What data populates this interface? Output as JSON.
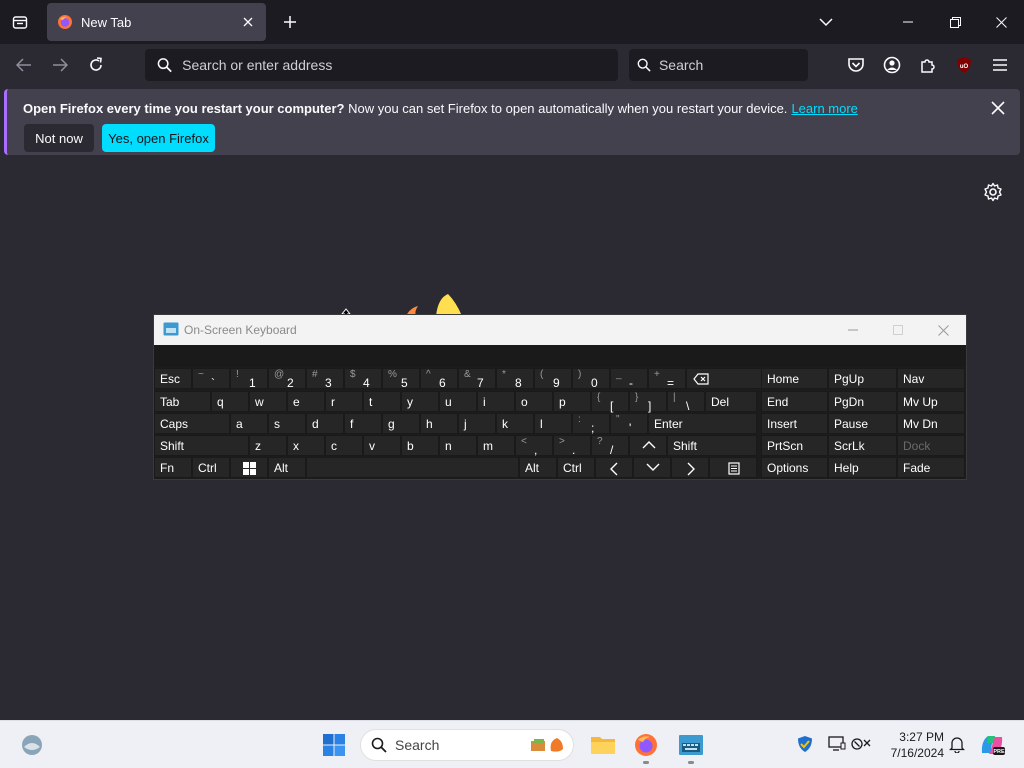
{
  "browser": {
    "tab": {
      "title": "New Tab"
    },
    "urlbar": {
      "placeholder": "Search or enter address"
    },
    "searchbar": {
      "placeholder": "Search"
    }
  },
  "notification": {
    "bold": "Open Firefox every time you restart your computer?",
    "text": " Now you can set Firefox to open automatically when you restart your device.",
    "link": "Learn more",
    "btn_not_now": "Not now",
    "btn_yes": "Yes, open Firefox"
  },
  "osk": {
    "title": "On-Screen Keyboard",
    "row1": [
      {
        "up": "~",
        "lo": "`"
      },
      {
        "up": "!",
        "lo": "1"
      },
      {
        "up": "@",
        "lo": "2"
      },
      {
        "up": "#",
        "lo": "3"
      },
      {
        "up": "$",
        "lo": "4"
      },
      {
        "up": "%",
        "lo": "5"
      },
      {
        "up": "^",
        "lo": "6"
      },
      {
        "up": "&",
        "lo": "7"
      },
      {
        "up": "*",
        "lo": "8"
      },
      {
        "up": "(",
        "lo": "9"
      },
      {
        "up": ")",
        "lo": "0"
      },
      {
        "up": "_",
        "lo": "-"
      },
      {
        "up": "+",
        "lo": "="
      }
    ],
    "letters_row2": [
      "q",
      "w",
      "e",
      "r",
      "t",
      "y",
      "u",
      "i",
      "o",
      "p"
    ],
    "row2_sym": [
      {
        "up": "{",
        "lo": "["
      },
      {
        "up": "}",
        "lo": "]"
      },
      {
        "up": "|",
        "lo": "\\"
      }
    ],
    "letters_row3": [
      "a",
      "s",
      "d",
      "f",
      "g",
      "h",
      "j",
      "k",
      "l"
    ],
    "row3_sym": [
      {
        "up": ":",
        "lo": ";"
      },
      {
        "up": "\"",
        "lo": "'"
      }
    ],
    "letters_row4": [
      "z",
      "x",
      "c",
      "v",
      "b",
      "n",
      "m"
    ],
    "row4_sym": [
      {
        "up": "<",
        "lo": ","
      },
      {
        "up": ">",
        "lo": "."
      },
      {
        "up": "?",
        "lo": "/"
      }
    ],
    "keys": {
      "esc": "Esc",
      "tab": "Tab",
      "caps": "Caps",
      "shift": "Shift",
      "shift_r": "Shift",
      "fn": "Fn",
      "ctrl": "Ctrl",
      "alt": "Alt",
      "alt_r": "Alt",
      "ctrl_r": "Ctrl",
      "del": "Del",
      "enter": "Enter"
    },
    "nav": [
      [
        "Home",
        "PgUp",
        "Nav"
      ],
      [
        "End",
        "PgDn",
        "Mv Up"
      ],
      [
        "Insert",
        "Pause",
        "Mv Dn"
      ],
      [
        "PrtScn",
        "ScrLk",
        "Dock"
      ],
      [
        "Options",
        "Help",
        "Fade"
      ]
    ]
  },
  "taskbar": {
    "search_placeholder": "Search",
    "time": "3:27 PM",
    "date": "7/16/2024"
  }
}
